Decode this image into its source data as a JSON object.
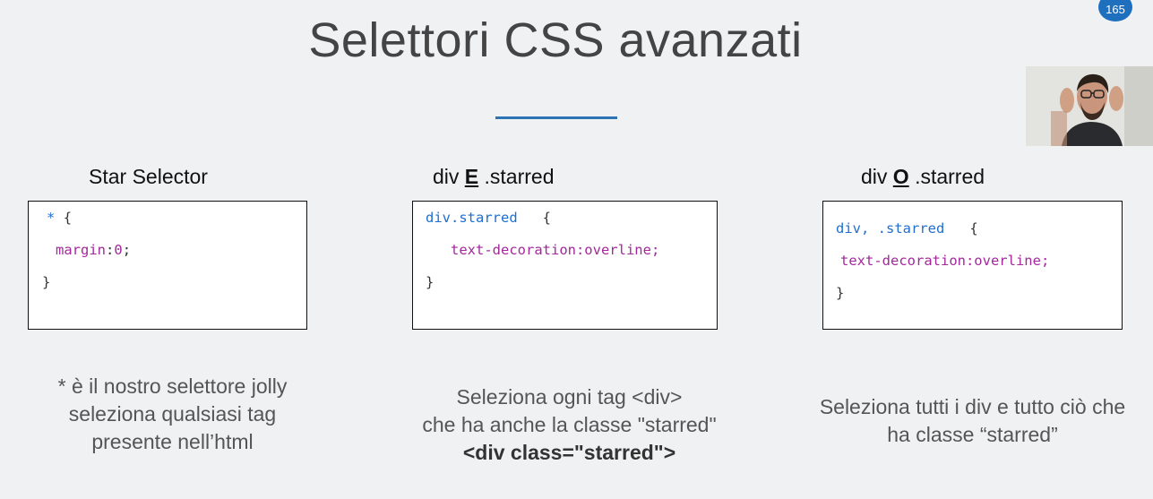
{
  "slide": {
    "title": "Selettori CSS avanzati",
    "page_number": "165",
    "accent_color": "#2e74b5"
  },
  "sections": [
    {
      "title": "Star Selector",
      "code": {
        "line1_selector": "*",
        "line1_brace": "{",
        "line2_prop": "margin",
        "line2_colon": ":",
        "line2_value": "0",
        "line2_semicolon": ";",
        "line3": "}"
      },
      "description": {
        "line1": "* è il nostro selettore jolly",
        "line2": "seleziona qualsiasi tag",
        "line3": "presente nell’html"
      }
    },
    {
      "title_prefix": "div ",
      "title_keyword": "E",
      "title_suffix": " .starred",
      "code": {
        "line1_selector": "div.starred",
        "line1_brace": "{",
        "line2": "text-decoration:overline;",
        "line3": "}"
      },
      "description": {
        "line1": "Seleziona ogni tag <div>",
        "line2": "che ha anche la classe \"starred\"",
        "line3": "<div class=\"starred\">"
      }
    },
    {
      "title_prefix": "div ",
      "title_keyword": "O",
      "title_suffix": " .starred",
      "code": {
        "line1_selector": "div, .starred",
        "line1_brace": "{",
        "line2": "text-decoration:overline;",
        "line3": "}"
      },
      "description": {
        "line1": "Seleziona tutti i div e tutto ciò che",
        "line2": "ha classe “starred”"
      }
    }
  ],
  "webcam": {
    "icon": "presenter-webcam"
  }
}
